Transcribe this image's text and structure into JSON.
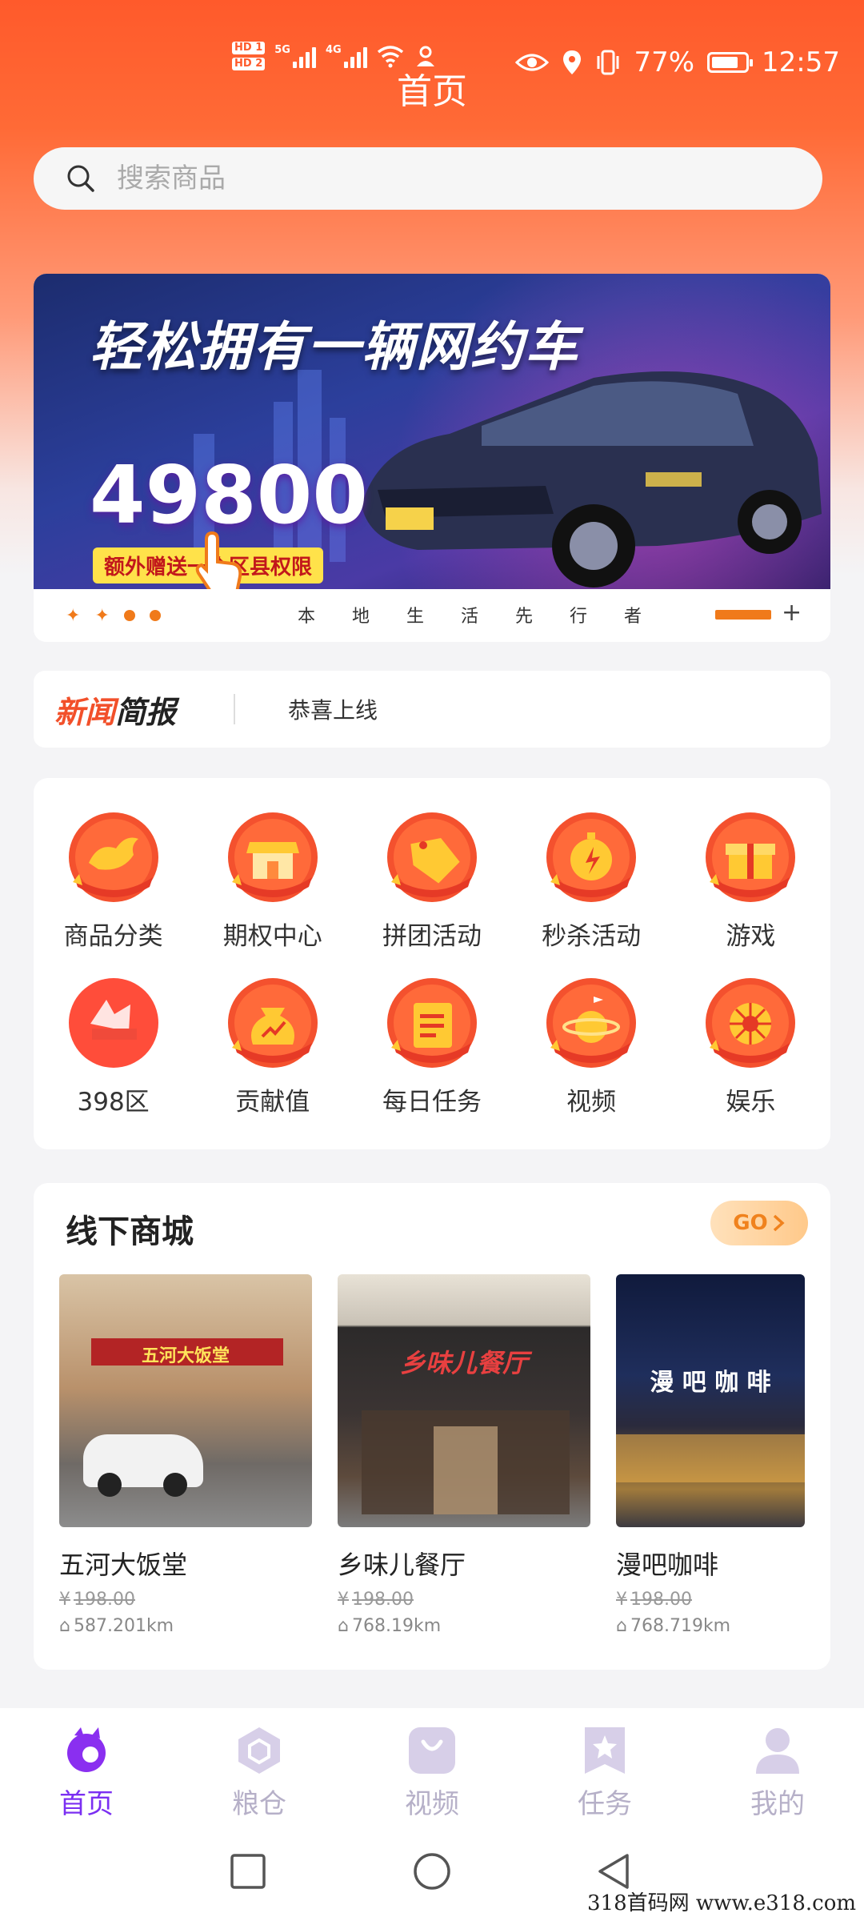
{
  "status_bar": {
    "sim1": "HD 1",
    "sim2": "HD 2",
    "net1": "5G",
    "net2": "4G",
    "battery": "77%",
    "time": "12:57"
  },
  "header": {
    "title": "首页"
  },
  "search": {
    "placeholder": "搜索商品"
  },
  "banner": {
    "headline": "轻松拥有一辆网约车",
    "price": "49800",
    "sub": "额外赠送一个区县权限",
    "slogan": "本地生活先行者",
    "plus": "+"
  },
  "news": {
    "logo_a": "新闻",
    "logo_b": "简报",
    "text": "恭喜上线"
  },
  "menu": {
    "items": [
      {
        "label": "商品分类",
        "icon": "bird-icon"
      },
      {
        "label": "期权中心",
        "icon": "store-icon"
      },
      {
        "label": "拼团活动",
        "icon": "sale-tag-icon"
      },
      {
        "label": "秒杀活动",
        "icon": "stopwatch-icon"
      },
      {
        "label": "游戏",
        "icon": "gift-box-icon"
      },
      {
        "label": "398区",
        "icon": "badge-icon"
      },
      {
        "label": "贡献值",
        "icon": "money-bag-icon"
      },
      {
        "label": "每日任务",
        "icon": "task-list-icon"
      },
      {
        "label": "视频",
        "icon": "planet-icon"
      },
      {
        "label": "娱乐",
        "icon": "wheel-icon"
      }
    ]
  },
  "shop": {
    "title": "线下商城",
    "go": "GO",
    "stores": [
      {
        "name": "五河大饭堂",
        "price": "198.00",
        "distance": "587.201km",
        "sign": "五河大饭堂"
      },
      {
        "name": "乡味儿餐厅",
        "price": "198.00",
        "distance": "768.19km",
        "sign": "乡味儿餐厅"
      },
      {
        "name": "漫吧咖啡",
        "price": "198.00",
        "distance": "768.719km",
        "sign": "漫 吧 咖 啡"
      }
    ]
  },
  "nav": {
    "items": [
      {
        "label": "首页",
        "active": true
      },
      {
        "label": "粮仓"
      },
      {
        "label": "视频"
      },
      {
        "label": "任务"
      },
      {
        "label": "我的"
      }
    ]
  },
  "watermark": "318首码网  www.e318.com",
  "colors": {
    "brand": "#ff5a2b",
    "accent": "#f07a1a",
    "nav_active": "#7b2ff2",
    "nav_inactive": "#b6b0c8"
  }
}
